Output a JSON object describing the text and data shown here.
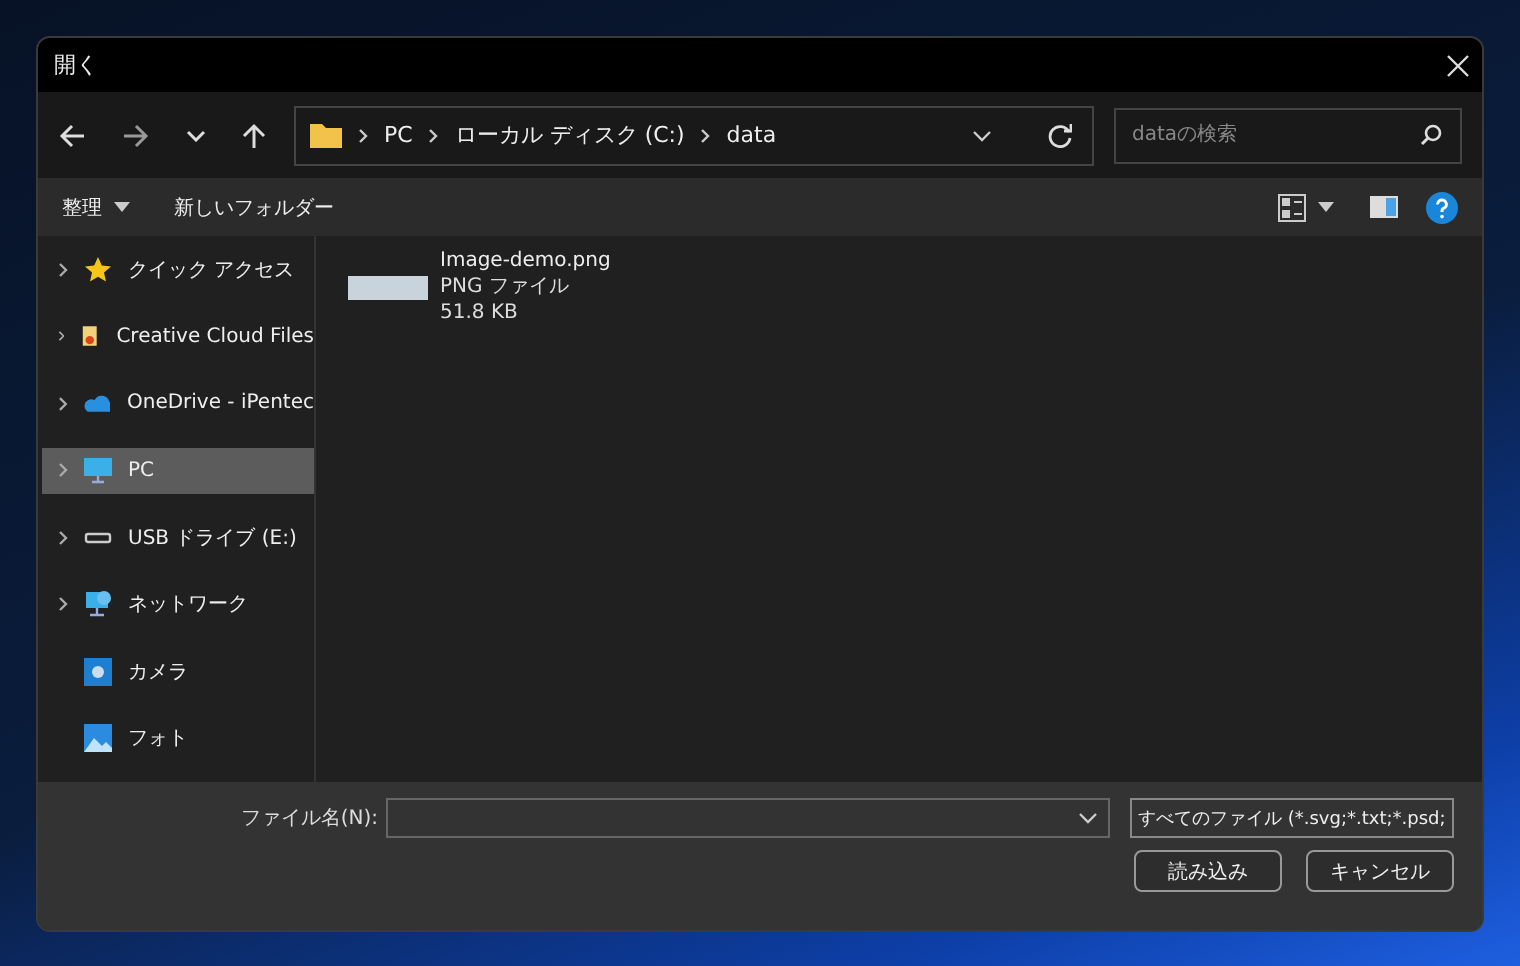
{
  "window": {
    "title": "開く"
  },
  "address_bar": {
    "segments": [
      "PC",
      "ローカル ディスク (C:)",
      "data"
    ]
  },
  "search": {
    "placeholder": "dataの検索"
  },
  "toolbar": {
    "organize": "整理",
    "new_folder": "新しいフォルダー"
  },
  "sidebar": {
    "items": [
      {
        "label": "クイック アクセス",
        "kind": "star",
        "expandable": true,
        "selected": false
      },
      {
        "label": "Creative Cloud Files",
        "kind": "cloudfiles",
        "expandable": true,
        "selected": false
      },
      {
        "label": "OneDrive - iPentec",
        "kind": "onedrive",
        "expandable": true,
        "selected": false
      },
      {
        "label": "PC",
        "kind": "pc",
        "expandable": true,
        "selected": true
      },
      {
        "label": "USB ドライブ (E:)",
        "kind": "drive",
        "expandable": true,
        "selected": false
      },
      {
        "label": "ネットワーク",
        "kind": "network",
        "expandable": true,
        "selected": false
      },
      {
        "label": "カメラ",
        "kind": "camera",
        "expandable": false,
        "selected": false
      },
      {
        "label": "フォト",
        "kind": "photo",
        "expandable": false,
        "selected": false
      }
    ]
  },
  "files": [
    {
      "name": "Image-demo.png",
      "type": "PNG ファイル",
      "size": "51.8 KB"
    }
  ],
  "footer": {
    "filename_label": "ファイル名(N):",
    "filter": "すべてのファイル (*.svg;*.txt;*.psd;",
    "open_button": "読み込み",
    "cancel_button": "キャンセル"
  }
}
